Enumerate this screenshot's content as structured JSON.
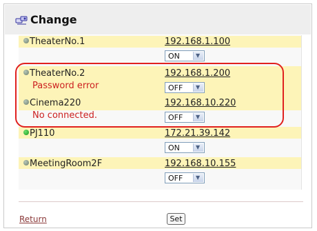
{
  "header": {
    "title": "Change"
  },
  "projectors": [
    {
      "name": "TheaterNo.1",
      "ip": "192.168.1.100",
      "value": "ON",
      "error": "",
      "status": "gray"
    },
    {
      "name": "TheaterNo.2",
      "ip": "192.168.1.200",
      "value": "OFF",
      "error": "Password error",
      "status": "gray"
    },
    {
      "name": "Cinema220",
      "ip": "192.168.10.220",
      "value": "OFF",
      "error": "No connected.",
      "status": "gray"
    },
    {
      "name": "PJ110",
      "ip": "172.21.39.142",
      "value": "ON",
      "error": "",
      "status": "green"
    },
    {
      "name": "MeetingRoom2F",
      "ip": "192.168.10.155",
      "value": "OFF",
      "error": "",
      "status": "gray"
    }
  ],
  "footer": {
    "return_label": "Return",
    "set_label": "Set"
  },
  "colors": {
    "highlight": "#fdf4b8",
    "error": "#cc2020",
    "annotation": "#e0201e"
  }
}
